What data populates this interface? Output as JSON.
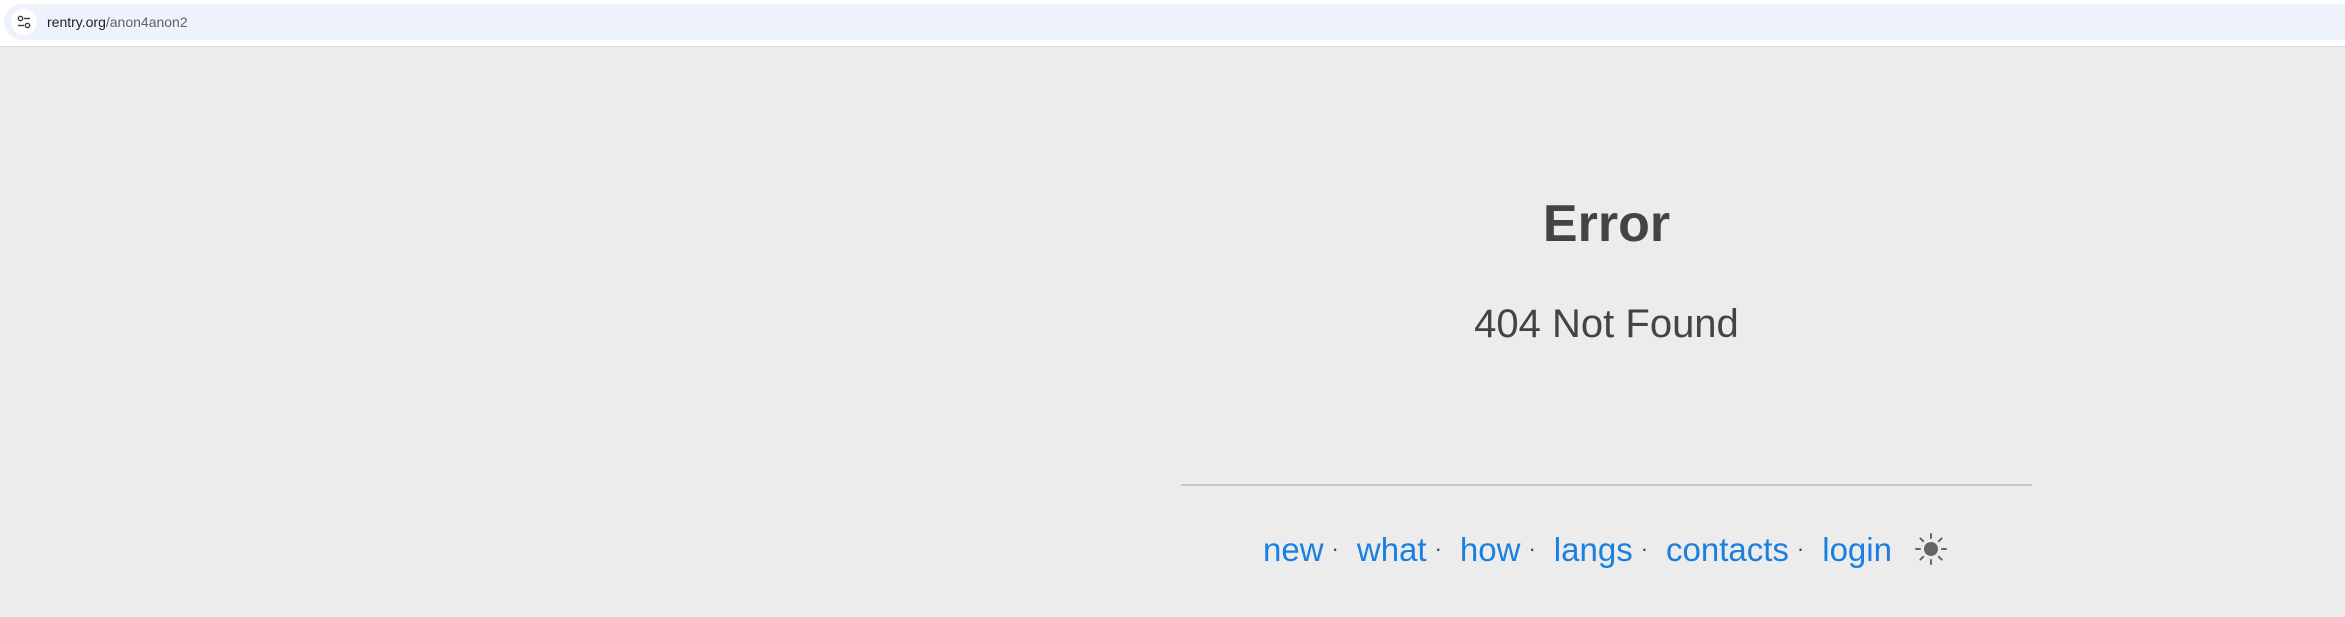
{
  "browser": {
    "url_domain": "rentry.org",
    "url_path": "/anon4anon2",
    "site_info_icon": "tune-icon"
  },
  "page": {
    "title": "Error",
    "message": "404 Not Found"
  },
  "footer": {
    "links": [
      {
        "label": "new"
      },
      {
        "label": "what"
      },
      {
        "label": "how"
      },
      {
        "label": "langs"
      },
      {
        "label": "contacts"
      },
      {
        "label": "login"
      }
    ],
    "separator": "·",
    "theme_icon": "sun-icon"
  },
  "colors": {
    "background": "#ececed",
    "text": "#444444",
    "link": "#1a7fe0"
  }
}
